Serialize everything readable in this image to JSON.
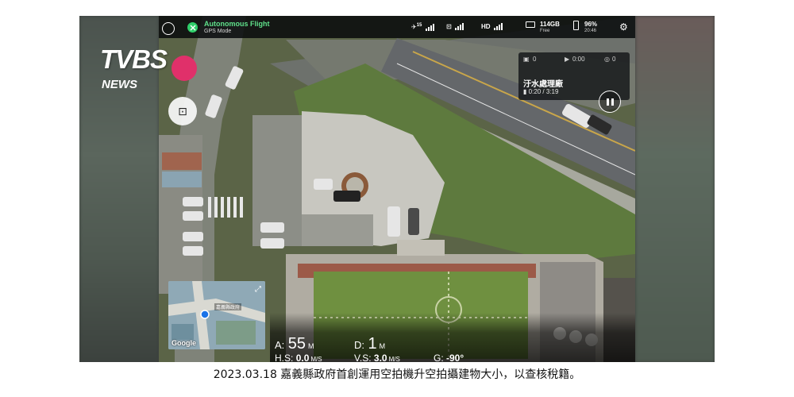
{
  "logo": {
    "main": "TVBS",
    "sub": "NEWS"
  },
  "status_bar": {
    "flight_mode_title": "Autonomous Flight",
    "flight_mode_sub": "GPS Mode",
    "satellites": "15",
    "video_signal": "HD",
    "storage": "114GB",
    "storage_label": "Free",
    "battery": "96%",
    "battery_time": "20:46"
  },
  "info_panel": {
    "photos": "0",
    "video_time": "0:00",
    "other_count": "0",
    "location_name": "汙水處理廠",
    "playback_time": "0:20 / 3:19"
  },
  "minimap": {
    "provider": "Google",
    "label": "嘉義縣政府"
  },
  "telemetry": {
    "altitude_label": "A:",
    "altitude_value": "55",
    "altitude_unit": "M",
    "distance_label": "D:",
    "distance_value": "1",
    "distance_unit": "M",
    "hs_label": "H.S:",
    "hs_value": "0.0",
    "hs_unit": "M/S",
    "vs_label": "V.S:",
    "vs_value": "3.0",
    "vs_unit": "M/S",
    "gimbal_label": "G:",
    "gimbal_value": "-90°"
  },
  "caption": "2023.03.18 嘉義縣政府首創運用空拍機升空拍攝建物大小，以查核稅籍。",
  "colors": {
    "mode_green": "#2fcf6a",
    "record_pink": "#e0306a"
  }
}
